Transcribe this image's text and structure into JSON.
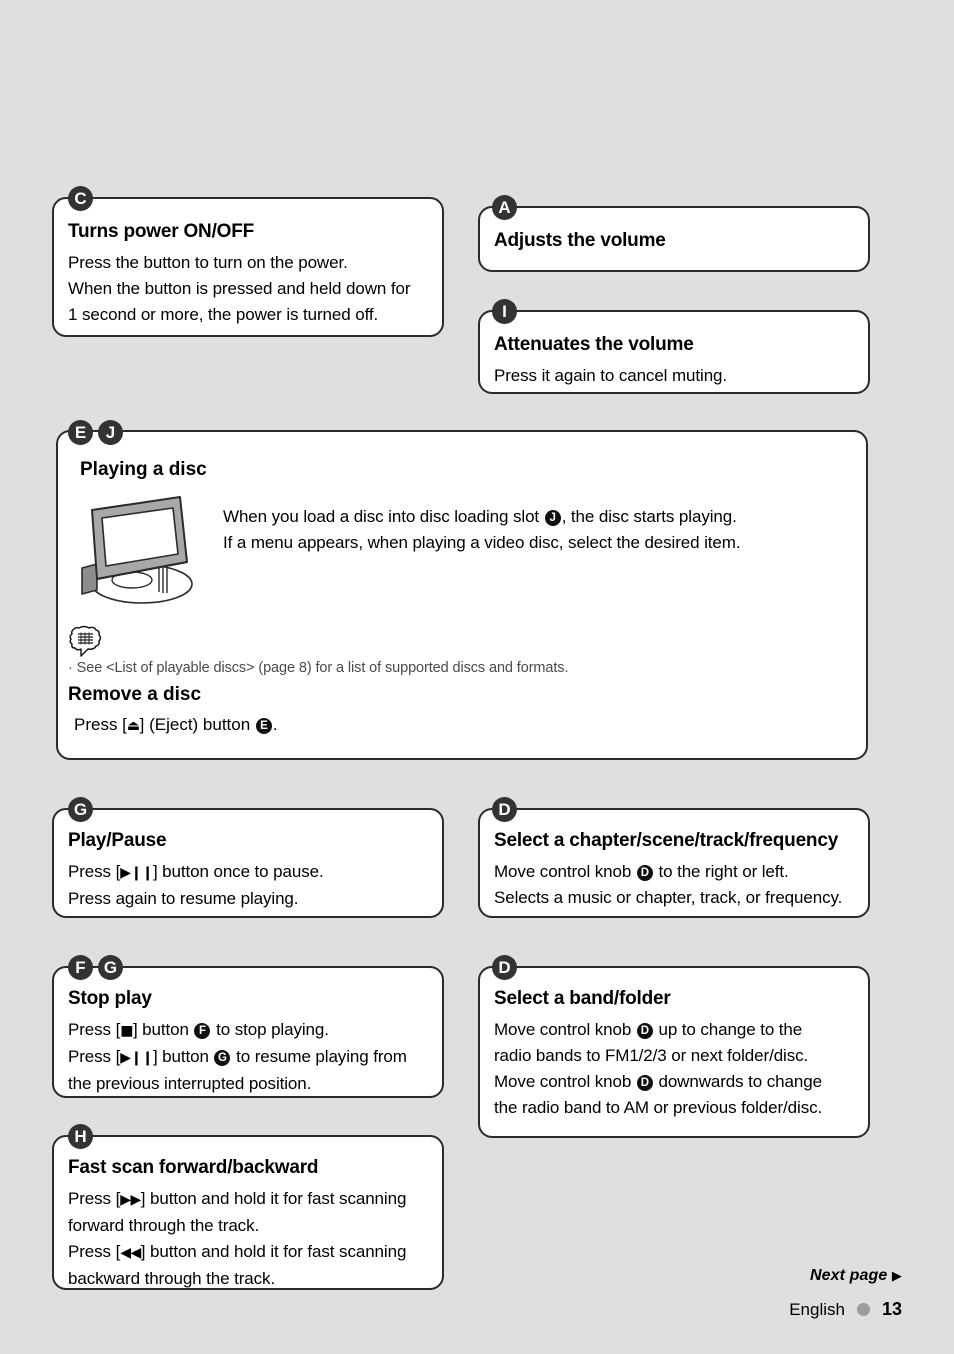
{
  "page": {
    "background_color": "#dfdfdf",
    "badge_color": "#333333"
  },
  "boxes": {
    "power": {
      "badges": [
        "C"
      ],
      "title": "Turns power ON/OFF",
      "lines": [
        "Press the button to turn on the power.",
        "When the button is pressed and held down for",
        "1 second or more, the power is turned off."
      ]
    },
    "volume": {
      "badges": [
        "A"
      ],
      "title": "Adjusts the volume",
      "lines": []
    },
    "attenuate": {
      "badges": [
        "I"
      ],
      "title": "Attenuates the volume",
      "lines": [
        "Press it again to cancel muting."
      ]
    },
    "disc": {
      "badges": [
        "E",
        "J"
      ],
      "title": "Playing a disc",
      "body_line_1_a": "When you load a disc into disc loading slot ",
      "body_line_1_badge": "J",
      "body_line_1_b": ", the disc starts playing.",
      "body_line_2": "If a menu appears, when playing a video disc, select the desired item.",
      "note": "· See <List of playable discs> (page 8) for a list of supported discs and formats.",
      "remove_title": "Remove a disc",
      "remove_line_a": "Press [",
      "remove_symbol": "⏏",
      "remove_line_b": "] (Eject) button ",
      "remove_badge": "E",
      "remove_line_c": "."
    },
    "playpause": {
      "badges": [
        "G"
      ],
      "title": "Play/Pause",
      "line1_a": "Press [",
      "line1_sym": "▶❙❙",
      "line1_b": "] button once to pause.",
      "line2": "Press again to resume playing."
    },
    "chapter": {
      "badges": [
        "D"
      ],
      "title": "Select a chapter/scene/track/frequency",
      "line1_a": "Move control knob ",
      "line1_badge": "D",
      "line1_b": " to the right or left.",
      "line2": "Selects a music or chapter, track, or frequency."
    },
    "stop": {
      "badges": [
        "F",
        "G"
      ],
      "title": "Stop play",
      "line1_a": "Press [",
      "line1_sym": "■",
      "line1_b": "] button ",
      "line1_badge": "F",
      "line1_c": " to stop playing.",
      "line2_a": "Press [",
      "line2_sym": "▶❙❙",
      "line2_b": "] button ",
      "line2_badge": "G",
      "line2_c": " to resume playing from",
      "line3": "the previous interrupted position."
    },
    "band": {
      "badges": [
        "D"
      ],
      "title": "Select a band/folder",
      "line1_a": "Move control knob ",
      "line1_badge": "D",
      "line1_b": " up to change to the",
      "line2": "radio bands to FM1/2/3 or next folder/disc.",
      "line3_a": "Move control knob ",
      "line3_badge": "D",
      "line3_b": " downwards to change",
      "line4": "the radio band to AM or previous folder/disc."
    },
    "fastscan": {
      "badges": [
        "H"
      ],
      "title": "Fast scan forward/backward",
      "line1_a": "Press [",
      "line1_sym": "▶▶",
      "line1_b": "] button and hold it for fast scanning",
      "line2": "forward through the track.",
      "line3_a": "Press [",
      "line3_sym": "◀◀",
      "line3_b": "] button and hold it for fast scanning",
      "line4": "backward through the track."
    }
  },
  "footer": {
    "next_page": "Next page",
    "next_arrow": "▶",
    "language": "English",
    "page_number": "13",
    "dot_color": "#9d9d9d"
  }
}
